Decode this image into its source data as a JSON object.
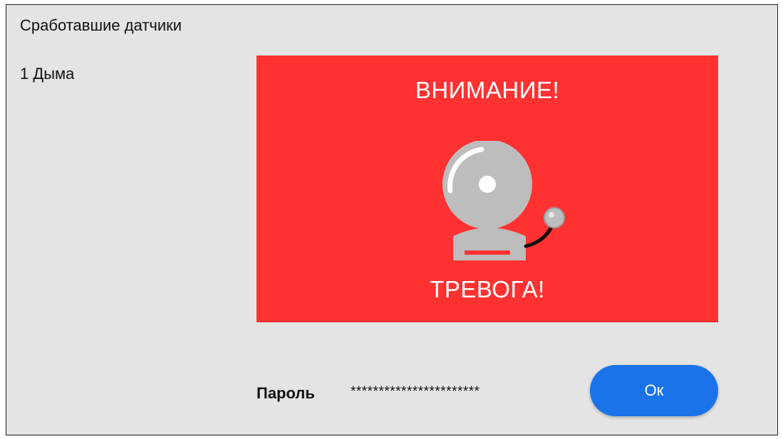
{
  "dialog": {
    "title": "Сработавшие датчики",
    "sensors": [
      "1 Дыма"
    ]
  },
  "alarm": {
    "heading": "ВНИМАНИЕ!",
    "footer": "ТРЕВОГА!",
    "background_color": "#ff3131",
    "icon": "bell-icon"
  },
  "password": {
    "label": "Пароль",
    "value": "***********************"
  },
  "buttons": {
    "ok_label": "Ок",
    "ok_color": "#1a73e8"
  }
}
